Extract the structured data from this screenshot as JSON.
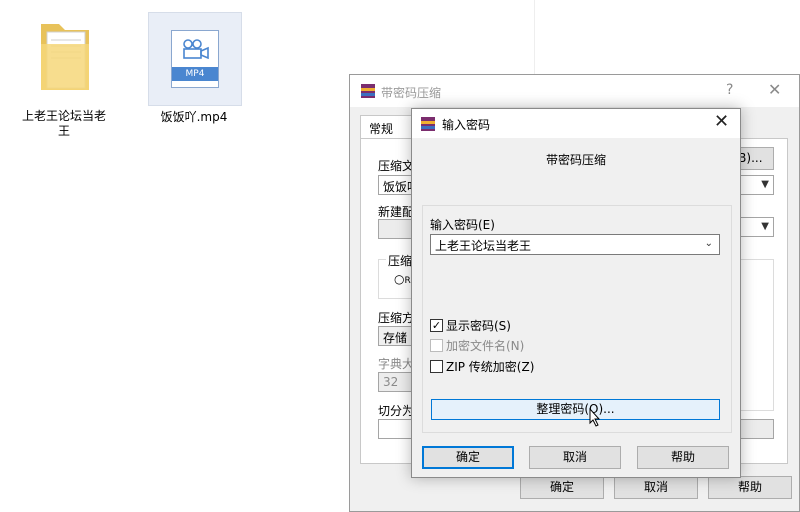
{
  "desktop": {
    "folder": {
      "icon": "folder-icon",
      "label": "上老王论坛当老王"
    },
    "video": {
      "icon": "mp4-file-icon",
      "badge": "MP4",
      "label": "饭饭吖.mp4"
    }
  },
  "background_dialog": {
    "title": "带密码压缩",
    "help": "?",
    "close": "✕",
    "tab": "常规",
    "labels": {
      "archive_name": "压缩文",
      "archive_value": "饭饭吖",
      "new_config": "新建配",
      "format_group": "压缩",
      "radio": "R",
      "method": "压缩方",
      "method_value": "存储",
      "dict": "字典大",
      "dict_value": "32",
      "split": "切分为"
    },
    "browse_button": "(B)...",
    "buttons": {
      "ok": "确定",
      "cancel": "取消",
      "help": "帮助"
    }
  },
  "password_dialog": {
    "title": "输入密码",
    "close": "✕",
    "heading": "带密码压缩",
    "password_label": "输入密码(E)",
    "password_value": "上老王论坛当老王",
    "show_password": {
      "label": "显示密码(S)",
      "checked": true
    },
    "encrypt_names": {
      "label": "加密文件名(N)",
      "checked": false,
      "disabled": true
    },
    "zip_legacy": {
      "label": "ZIP 传统加密(Z)",
      "checked": false
    },
    "organize_button": "整理密码(O)...",
    "buttons": {
      "ok": "确定",
      "cancel": "取消",
      "help": "帮助"
    }
  }
}
